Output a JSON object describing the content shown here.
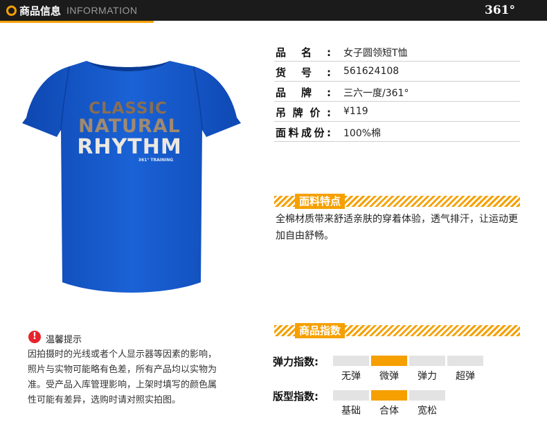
{
  "header": {
    "title_zh": "商品信息",
    "title_en": "INFORMATION",
    "brand": "361°"
  },
  "product_image": {
    "print_line1": "CLASSIC",
    "print_line2": "NATURAL",
    "print_line3": "RHYTHM",
    "print_tag": "361° TRAINING",
    "colors": {
      "shirt": "#1457c8",
      "shirt_shade": "#0e43a3",
      "print_copper": "#8a6e52",
      "print_silver": "#e9e6df"
    }
  },
  "specs": [
    {
      "label": "品名:",
      "value": "女子圆领短T恤"
    },
    {
      "label": "货号:",
      "value": "561624108"
    },
    {
      "label": "品牌:",
      "value": "三六一度/361°"
    },
    {
      "label": "吊牌价:",
      "value": "¥119"
    },
    {
      "label": "面料成份:",
      "value": "100%棉"
    }
  ],
  "fabric": {
    "title": "面料特点",
    "text": "全棉材质带来舒适亲肤的穿着体验，透气排汗，让运动更加自由舒畅。"
  },
  "indices": {
    "title": "商品指数",
    "elasticity": {
      "label": "弹力指数:",
      "options": [
        "无弹",
        "微弹",
        "弹力",
        "超弹"
      ],
      "selected_index": 1
    },
    "fit": {
      "label": "版型指数:",
      "options": [
        "基础",
        "合体",
        "宽松"
      ],
      "selected_index": 1
    }
  },
  "notice": {
    "icon": "exclamation-icon",
    "title": "温馨提示",
    "text": "因拍摄时的光线或者个人显示器等因素的影响，照片与实物可能略有色差，所有产品均以实物为准。受产品入库管理影响，上架时填写的颜色属性可能有差异，选购时请对照实拍图。"
  },
  "accent_color": "#f5a000"
}
